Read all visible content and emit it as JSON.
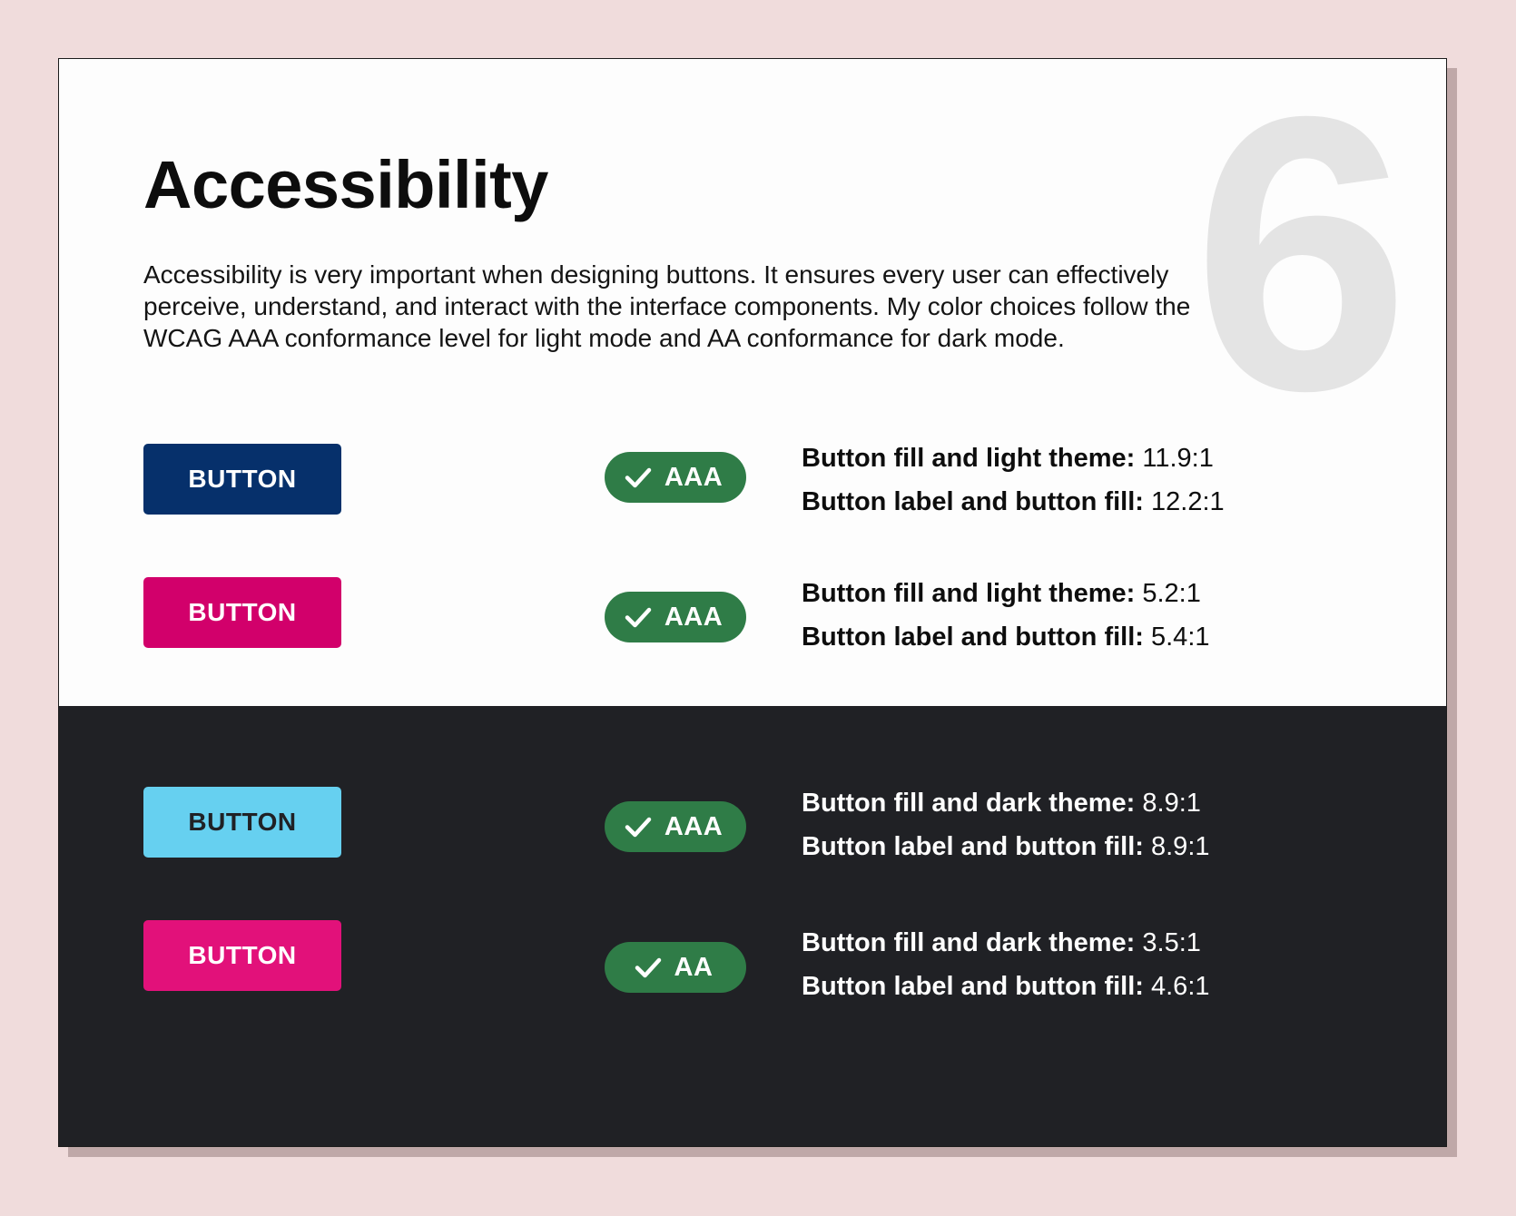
{
  "page": {
    "section_number": "6",
    "title": "Accessibility",
    "intro": "Accessibility is very important when designing buttons. It ensures every user can effectively perceive, understand, and interact with the interface components. My color choices follow the WCAG AAA conformance level for light mode and AA conformance for dark mode."
  },
  "colors": {
    "page_background": "#f0dcdc",
    "light_theme_background": "#fdfdfd",
    "dark_theme_background": "#202125",
    "badge_fill": "#2f7c47"
  },
  "light_rows": [
    {
      "button_label": "BUTTON",
      "button_fill": "#06306b",
      "button_label_color": "#ffffff",
      "badge": "AAA",
      "line1_label": "Button fill and light theme:",
      "line1_value": "11.9:1",
      "line2_label": "Button label and button fill:",
      "line2_value": "12.2:1"
    },
    {
      "button_label": "BUTTON",
      "button_fill": "#d2006b",
      "button_label_color": "#ffffff",
      "badge": "AAA",
      "line1_label": "Button fill and light theme:",
      "line1_value": "5.2:1",
      "line2_label": "Button label and button fill:",
      "line2_value": "5.4:1"
    }
  ],
  "dark_rows": [
    {
      "button_label": "BUTTON",
      "button_fill": "#66d0f0",
      "button_label_color": "#202125",
      "badge": "AAA",
      "line1_label": "Button fill and dark theme:",
      "line1_value": "8.9:1",
      "line2_label": "Button label and button fill:",
      "line2_value": "8.9:1"
    },
    {
      "button_label": "BUTTON",
      "button_fill": "#e2117a",
      "button_label_color": "#ffffff",
      "badge": "AA",
      "line1_label": "Button fill and dark theme:",
      "line1_value": "3.5:1",
      "line2_label": "Button label and button fill:",
      "line2_value": "4.6:1"
    }
  ],
  "icons": {
    "badge_icon": "checkmark-icon"
  }
}
